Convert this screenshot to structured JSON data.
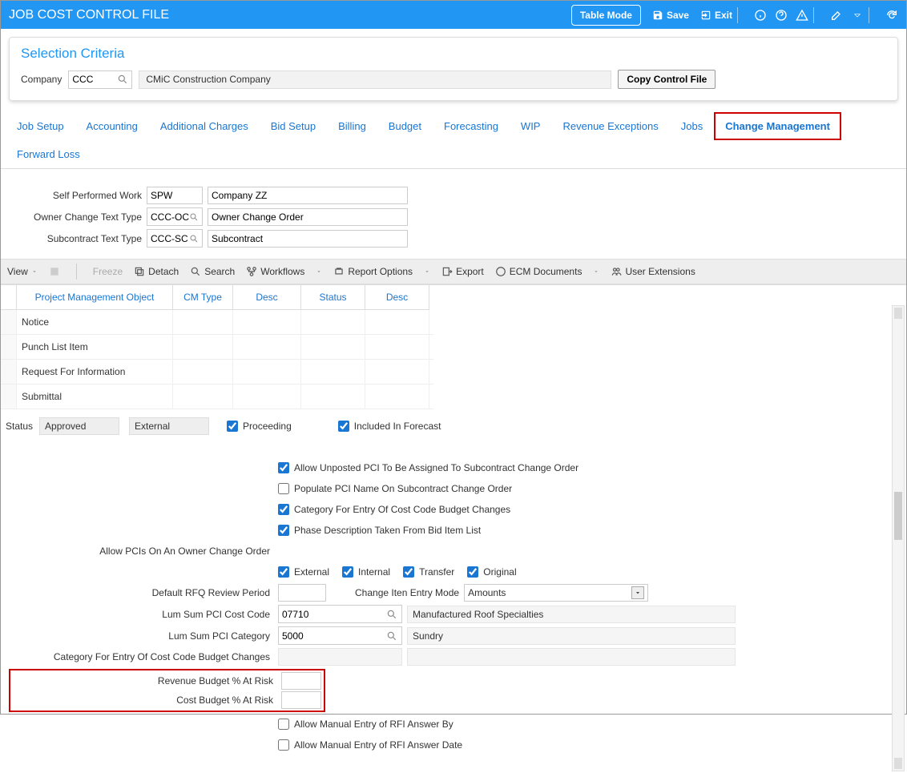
{
  "header": {
    "title": "JOB COST CONTROL FILE",
    "table_mode": "Table Mode",
    "save": "Save",
    "exit": "Exit"
  },
  "criteria": {
    "panel_title": "Selection Criteria",
    "company_label": "Company",
    "company_value": "CCC",
    "company_desc": "CMiC Construction Company",
    "copy_btn": "Copy Control File"
  },
  "tabs": {
    "job_setup": "Job Setup",
    "accounting": "Accounting",
    "additional_charges": "Additional Charges",
    "bid_setup": "Bid Setup",
    "billing": "Billing",
    "budget": "Budget",
    "forecasting": "Forecasting",
    "wip": "WIP",
    "revenue_exceptions": "Revenue Exceptions",
    "jobs": "Jobs",
    "change_management": "Change Management",
    "forward_loss": "Forward Loss"
  },
  "top_form": {
    "spw_label": "Self Performed Work",
    "spw_code": "SPW",
    "spw_desc": "Company ZZ",
    "owner_label": "Owner Change Text Type",
    "owner_code": "CCC-OCO",
    "owner_desc": "Owner Change Order",
    "sub_label": "Subcontract Text Type",
    "sub_code": "CCC-SC",
    "sub_desc": "Subcontract"
  },
  "toolbar": {
    "view": "View",
    "freeze": "Freeze",
    "detach": "Detach",
    "search": "Search",
    "workflows": "Workflows",
    "report_options": "Report Options",
    "export": "Export",
    "ecm_documents": "ECM Documents",
    "user_extensions": "User Extensions"
  },
  "grid": {
    "headers": {
      "pmo": "Project Management Object",
      "cm_type": "CM Type",
      "desc1": "Desc",
      "status": "Status",
      "desc2": "Desc"
    },
    "rows": [
      {
        "obj": "Notice"
      },
      {
        "obj": "Punch List Item"
      },
      {
        "obj": "Request For Information"
      },
      {
        "obj": "Submittal"
      }
    ]
  },
  "status_row": {
    "status_label": "Status",
    "status_value": "Approved",
    "external_label": "External",
    "proceeding": "Proceeding",
    "included": "Included In Forecast"
  },
  "lower": {
    "allow_unposted": "Allow Unposted PCI To Be Assigned To Subcontract Change Order",
    "populate_pci": "Populate PCI Name On Subcontract Change Order",
    "category_cost_code": "Category For Entry Of Cost Code Budget Changes",
    "phase_desc": "Phase Description Taken From Bid Item List",
    "allow_pcis_label": "Allow PCIs On An Owner Change Order",
    "external": "External",
    "internal": "Internal",
    "transfer": "Transfer",
    "original": "Original",
    "rfq_label": "Default RFQ Review Period",
    "change_mode_label": "Change Iten Entry Mode",
    "change_mode_value": "Amounts",
    "lum_code_label": "Lum Sum PCI Cost Code",
    "lum_code_value": "07710",
    "lum_code_desc": "Manufactured Roof Specialties",
    "lum_cat_label": "Lum Sum PCI Category",
    "lum_cat_value": "5000",
    "lum_cat_desc": "Sundry",
    "cat_entry_label": "Category For Entry Of Cost Code Budget Changes",
    "revenue_risk_label": "Revenue Budget % At Risk",
    "cost_risk_label": "Cost Budget % At Risk",
    "allow_rfi_by": "Allow Manual Entry of RFI Answer By",
    "allow_rfi_date": "Allow Manual Entry of RFI Answer Date"
  }
}
